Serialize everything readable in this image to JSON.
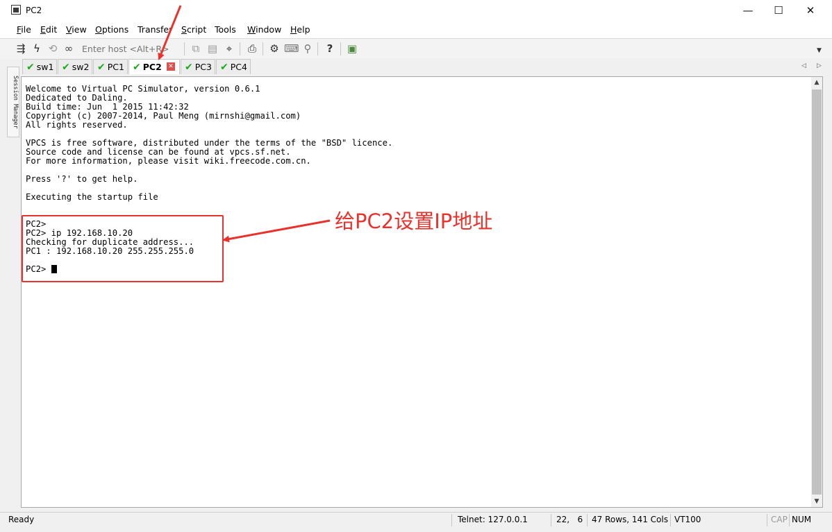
{
  "window": {
    "title": "PC2",
    "minimize": "—",
    "maximize": "☐",
    "close": "✕"
  },
  "menu": [
    {
      "pre": "",
      "u": "F",
      "post": "ile"
    },
    {
      "pre": "",
      "u": "E",
      "post": "dit"
    },
    {
      "pre": "",
      "u": "V",
      "post": "iew"
    },
    {
      "pre": "",
      "u": "O",
      "post": "ptions"
    },
    {
      "pre": "",
      "u": "",
      "post": "Transfer"
    },
    {
      "pre": "",
      "u": "S",
      "post": "cript"
    },
    {
      "pre": "",
      "u": "",
      "post": "Tools"
    },
    {
      "pre": "",
      "u": "W",
      "post": "indow"
    },
    {
      "pre": "",
      "u": "H",
      "post": "elp"
    }
  ],
  "toolbar": {
    "host_placeholder": "Enter host <Alt+R>",
    "icons": [
      "connect-icon",
      "quick-connect-icon",
      "reconnect-icon",
      "disconnect-icon",
      "copy-icon",
      "paste-icon",
      "find-icon",
      "print-icon",
      "settings-icon",
      "keymap-icon",
      "sftp-icon",
      "help-icon",
      "about-icon"
    ]
  },
  "sidebar": {
    "label": "Session Manager"
  },
  "tabs": [
    {
      "label": "sw1",
      "active": false
    },
    {
      "label": "sw2",
      "active": false
    },
    {
      "label": "PC1",
      "active": false
    },
    {
      "label": "PC2",
      "active": true
    },
    {
      "label": "PC3",
      "active": false
    },
    {
      "label": "PC4",
      "active": false
    }
  ],
  "terminal": {
    "lines": [
      "Welcome to Virtual PC Simulator, version 0.6.1",
      "Dedicated to Daling.",
      "Build time: Jun  1 2015 11:42:32",
      "Copyright (c) 2007-2014, Paul Meng (mirnshi@gmail.com)",
      "All rights reserved.",
      "",
      "VPCS is free software, distributed under the terms of the \"BSD\" licence.",
      "Source code and license can be found at vpcs.sf.net.",
      "For more information, please visit wiki.freecode.com.cn.",
      "",
      "Press '?' to get help.",
      "",
      "Executing the startup file",
      "",
      "",
      "PC2>",
      "PC2> ip 192.168.10.20",
      "Checking for duplicate address...",
      "PC1 : 192.168.10.20 255.255.255.0",
      ""
    ],
    "prompt": "PC2> "
  },
  "annotation": {
    "text": "给PC2设置IP地址",
    "color": "#e8322b"
  },
  "status": {
    "ready": "Ready",
    "connection": "Telnet: 127.0.0.1",
    "cursor_pos": "22,   6",
    "size": "47 Rows, 141 Cols",
    "emulation": "VT100",
    "cap": "CAP",
    "num": "NUM"
  }
}
